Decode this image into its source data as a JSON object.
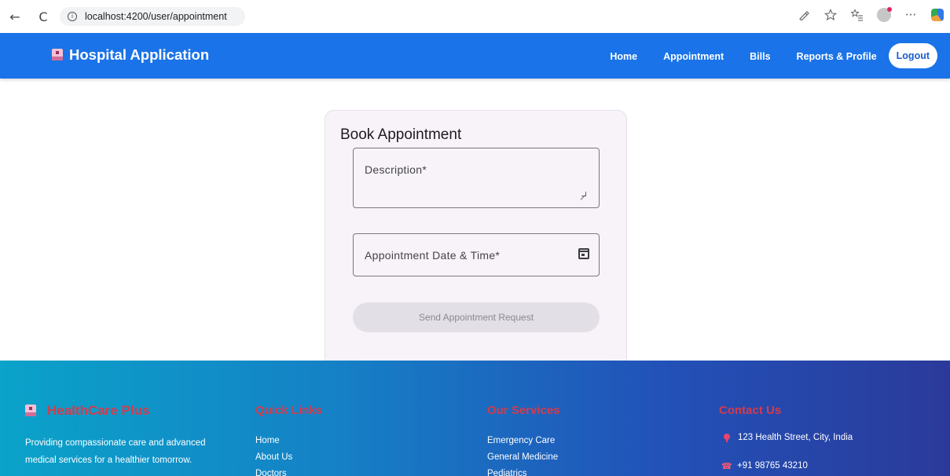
{
  "browser": {
    "url": "localhost:4200/user/appointment",
    "back_glyph": "←",
    "reload_glyph": "C",
    "info_glyph": "i",
    "icons": [
      "read-aloud-icon",
      "favorite-star-icon",
      "favorites-list-icon",
      "profile-icon",
      "more-icon",
      "copilot-icon"
    ],
    "more_glyph": "···"
  },
  "header": {
    "brand": "Hospital Application",
    "nav": {
      "home": "Home",
      "appointment": "Appointment",
      "bills": "Bills",
      "reports": "Reports & Profile",
      "logout": "Logout"
    },
    "accent_color": "#1a73e8"
  },
  "card": {
    "title": "Book Appointment",
    "description_label": "Description*",
    "datetime_label": "Appointment Date & Time*",
    "submit_label": "Send Appointment Request"
  },
  "footer": {
    "brand": "HealthCare Plus",
    "description": "Providing compassionate care and advanced medical services for a healthier tomorrow.",
    "quick_links": {
      "heading": "Quick Links",
      "items": [
        "Home",
        "About Us",
        "Doctors"
      ]
    },
    "services": {
      "heading": "Our Services",
      "items": [
        "Emergency Care",
        "General Medicine",
        "Pediatrics"
      ]
    },
    "contact": {
      "heading": "Contact Us",
      "address": "123 Health Street, City, India",
      "phone": "+91 98765 43210"
    },
    "heading_color": "#d63a4a"
  }
}
